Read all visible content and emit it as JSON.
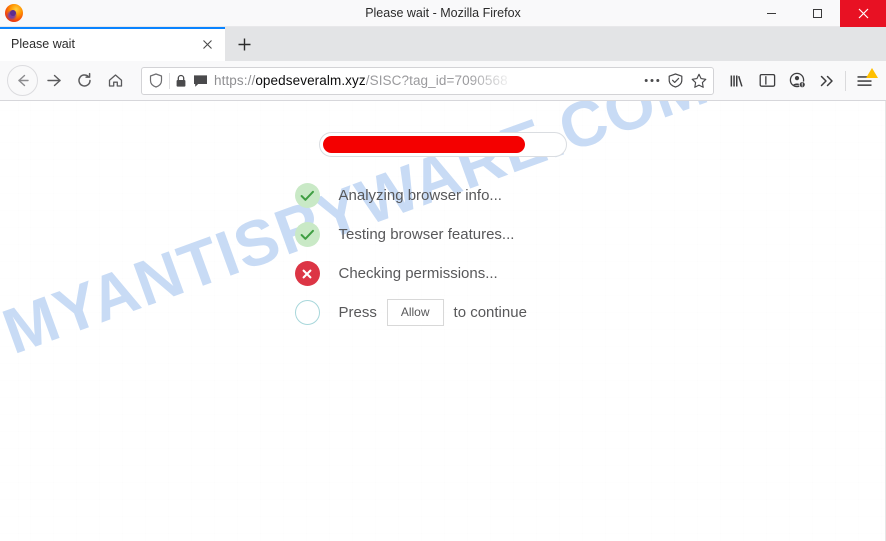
{
  "window": {
    "title": "Please wait - Mozilla Firefox",
    "logo_icon": "firefox-logo",
    "minimize_label": "Minimize",
    "maximize_label": "Maximize",
    "close_label": "Close"
  },
  "tabs": {
    "active": {
      "label": "Please wait",
      "close_icon": "close-icon"
    },
    "new_tab_icon": "plus-icon"
  },
  "nav": {
    "back_icon": "back-arrow-icon",
    "forward_icon": "forward-arrow-icon",
    "reload_icon": "reload-icon",
    "home_icon": "home-icon",
    "library_icon": "library-icon",
    "sidebar_icon": "sidebar-icon",
    "account_icon": "account-icon",
    "overflow_icon": "chevron-double-right-icon",
    "menu_icon": "hamburger-menu-icon"
  },
  "urlbar": {
    "shield_icon": "shield-icon",
    "lock_icon": "padlock-icon",
    "permissions_icon": "speech-bubble-icon",
    "scheme": "https://",
    "host": "opedseveralm.xyz",
    "path": "/SISC?tag_id=7090568",
    "full_url": "https://opedseveralm.xyz/SISC?tag_id=7090568",
    "page_actions_icon": "ellipsis-icon",
    "reader_icon": "reader-view-icon",
    "bookmark_icon": "star-icon"
  },
  "page": {
    "watermark": "MYANTISPYWARE.COM",
    "progress": {
      "percent": 84,
      "color": "#f40000"
    },
    "checklist": [
      {
        "status": "ok",
        "icon": "check-icon",
        "text": "Analyzing browser info..."
      },
      {
        "status": "ok",
        "icon": "check-icon",
        "text": "Testing browser features..."
      },
      {
        "status": "bad",
        "icon": "cross-icon",
        "text": "Checking permissions..."
      },
      {
        "status": "pending",
        "icon": "empty-circle-icon",
        "text_before": "Press",
        "button_label": "Allow",
        "text_after": "to continue"
      }
    ]
  },
  "colors": {
    "accent": "#0a84ff",
    "danger": "#dc3545",
    "progress": "#f40000",
    "success_bg": "#c9e9c6",
    "watermark": "#c3d8f4",
    "close_button": "#e81123"
  }
}
